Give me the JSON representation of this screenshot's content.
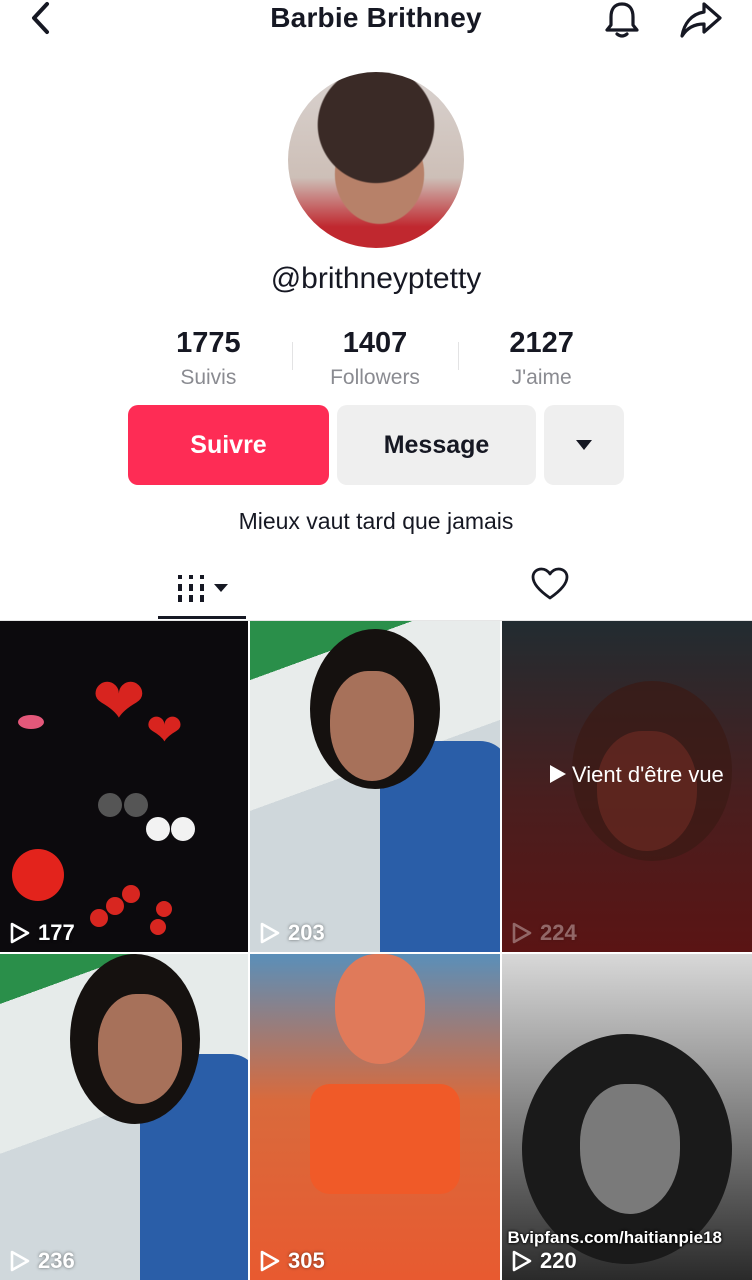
{
  "header": {
    "title": "Barbie Brithney",
    "back_icon": "chevron-left-icon",
    "bell_icon": "bell-icon",
    "share_icon": "share-arrow-icon"
  },
  "profile": {
    "handle": "@brithneyptetty",
    "bio": "Mieux vaut tard que jamais"
  },
  "stats": [
    {
      "value": "1775",
      "label": "Suivis"
    },
    {
      "value": "1407",
      "label": "Followers"
    },
    {
      "value": "2127",
      "label": "J'aime"
    }
  ],
  "actions": {
    "follow_label": "Suivre",
    "message_label": "Message",
    "more_icon": "caret-down-icon"
  },
  "tabs": {
    "videos_icon": "grid-icon",
    "liked_icon": "heart-outline-icon",
    "active": "videos"
  },
  "videos": [
    {
      "views": "177"
    },
    {
      "views": "203"
    },
    {
      "views": "224",
      "overlay": "Vient d'être vue"
    },
    {
      "views": "236"
    },
    {
      "views": "305"
    },
    {
      "views": "220",
      "watermark": "Bvipfans.com/haitianpie18"
    }
  ],
  "colors": {
    "accent": "#fe2c55",
    "button_gray": "#efefef",
    "text_primary": "#161823",
    "text_secondary": "#8a8b91"
  }
}
